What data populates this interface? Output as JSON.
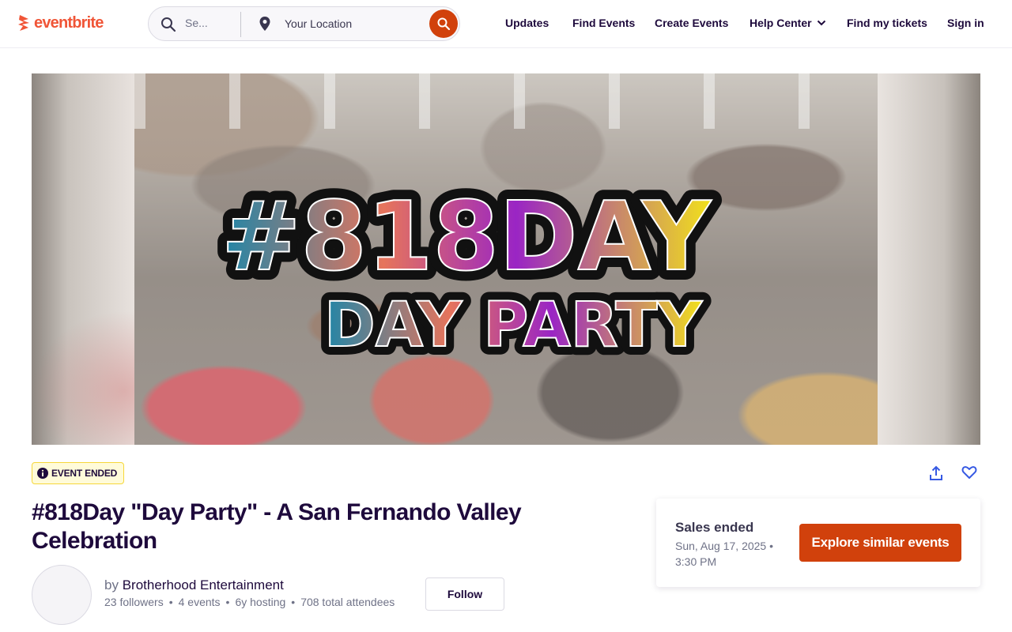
{
  "header": {
    "logo_text": "eventbrite",
    "search_placeholder": "Se...",
    "location_text": "Your Location",
    "nav": {
      "updates": "Updates",
      "find_events": "Find Events",
      "create_events": "Create Events",
      "help_center": "Help Center",
      "find_tickets": "Find my tickets",
      "sign_in": "Sign in"
    }
  },
  "hero": {
    "image_text_line1": "#818DAY",
    "image_text_line2": "DAY PARTY"
  },
  "event": {
    "status_badge": "EVENT ENDED",
    "title": "#818Day \"Day Party\" - A San Fernando Valley Celebration",
    "organizer_prefix": "by",
    "organizer_name": "Brotherhood Entertainment",
    "stats": {
      "followers": "23 followers",
      "events": "4 events",
      "hosting": "6y hosting",
      "attendees": "708 total attendees"
    },
    "follow_label": "Follow"
  },
  "sales": {
    "title": "Sales ended",
    "date": "Sun, Aug 17, 2025 • 3:30 PM",
    "cta": "Explore similar events"
  },
  "colors": {
    "brand": "#f05537",
    "accent": "#d1410c",
    "text_primary": "#1e0a3c",
    "badge_bg": "#fffbd9",
    "badge_border": "#f6d73a",
    "link_icon": "#3659e3"
  },
  "icons": {
    "logo": "eventbrite-flame-icon",
    "search": "search-icon",
    "location": "location-pin-icon",
    "search_go": "search-submit-icon",
    "help_chevron": "chevron-down-icon",
    "badge": "info-icon",
    "share": "share-icon",
    "like": "heart-icon"
  }
}
